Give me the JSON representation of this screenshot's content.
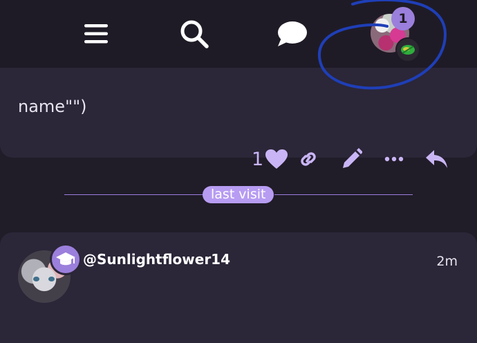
{
  "header": {
    "menu_icon": "hamburger-menu-icon",
    "search_icon": "search-icon",
    "chat_icon": "chat-bubble-icon",
    "notification_count": "1"
  },
  "previous_post": {
    "snippet": "name\"\")",
    "like_count": "1",
    "actions": [
      "heart-icon",
      "link-icon",
      "pencil-icon",
      "more-icon",
      "reply-icon"
    ]
  },
  "divider": {
    "label": "last visit"
  },
  "post": {
    "username": "@Sunlightflower14",
    "time": "2m",
    "badge_icon": "graduation-cap-icon"
  },
  "colors": {
    "background": "#201c28",
    "card": "#2b2638",
    "accent": "#9b7fdc",
    "accent_light": "#c9b5f5",
    "annotation": "#1f3fb8"
  }
}
